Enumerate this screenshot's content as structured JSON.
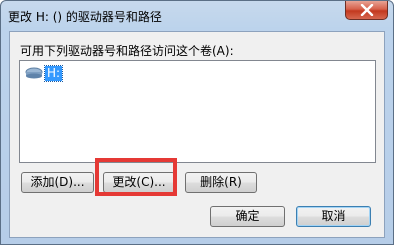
{
  "window": {
    "title": "更改 H: () 的驱动器号和路径"
  },
  "dialog": {
    "instruction": "可用下列驱动器号和路径访问这个卷(A):",
    "list_items": [
      {
        "label": "H:",
        "icon": "drive-icon"
      }
    ],
    "buttons": {
      "add": "添加(D)...",
      "change": "更改(C)...",
      "delete": "删除(R)",
      "ok": "确定",
      "cancel": "取消"
    }
  },
  "colors": {
    "selection": "#3399ff",
    "highlight_box": "#e53935",
    "close_button": "#c3391f"
  }
}
